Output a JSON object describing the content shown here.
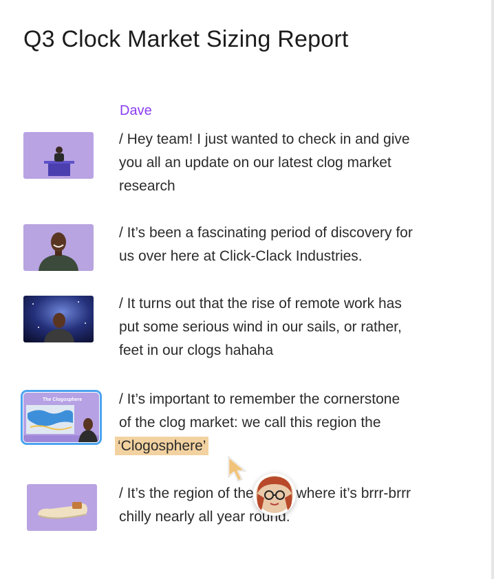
{
  "document": {
    "title": "Q3 Clock Market Sizing Report",
    "speaker": "Dave"
  },
  "segments": [
    {
      "text": "/ Hey team! I just wanted to check in and give\nyou all an update on our latest clog market\nresearch",
      "thumbnail_icon": "video-frame-desk"
    },
    {
      "text": "/ It’s been a fascinating period of discovery for\nus over here at Click-Clack Industries.",
      "thumbnail_icon": "video-frame-portrait"
    },
    {
      "text": "/ It turns out that the rise of remote work has\nput some serious wind in our sails, or rather,\nfeet in our clogs hahaha",
      "thumbnail_icon": "video-frame-space"
    },
    {
      "text_before": "/ It’s important to remember the cornerstone\nof the clog market: we call this region the\n",
      "highlighted": "‘Clogosphere’",
      "thumbnail_icon": "video-frame-slide",
      "thumbnail_slide_title": "The Clogosphere"
    },
    {
      "text": "/ It’s the region of the world where it’s brrr-brrr\nchilly nearly all year round.",
      "thumbnail_icon": "video-frame-clog"
    }
  ],
  "colors": {
    "speaker": "#8a3cf0",
    "highlight": "#f2d2a0",
    "selection_outline": "#4aa3f0",
    "thumb_purple": "#b9a3e3"
  },
  "icons": {
    "cursor": "arrow-cursor-icon",
    "collaborator": "collaborator-avatar"
  }
}
